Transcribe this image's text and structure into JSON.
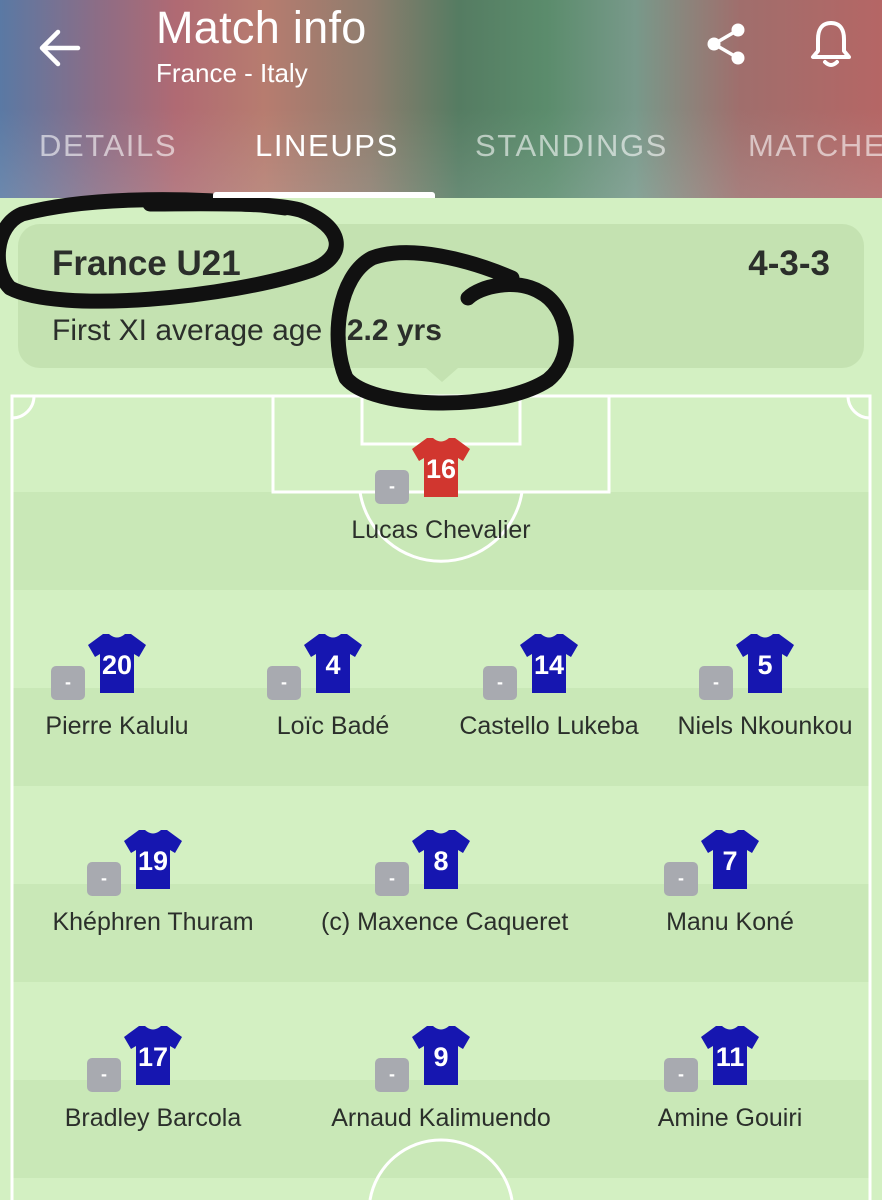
{
  "header": {
    "title": "Match info",
    "subtitle": "France - Italy",
    "back_icon": "arrow-left-icon",
    "share_icon": "share-icon",
    "bell_icon": "bell-icon"
  },
  "tabs": [
    {
      "label": "DETAILS",
      "active": false
    },
    {
      "label": "LINEUPS",
      "active": true
    },
    {
      "label": "STANDINGS",
      "active": false
    },
    {
      "label": "MATCHES",
      "active": false
    }
  ],
  "team": {
    "name": "France U21",
    "formation": "4-3-3",
    "avg_age_label": "First XI average age",
    "avg_age_value": "22.2 yrs"
  },
  "colors": {
    "pitch": "#d3f0c2",
    "pitch_stripe": "#c9e8b7",
    "keeper_shirt": "#d1362f",
    "outfield_shirt": "#1616b0",
    "rating_badge": "#a8aab0"
  },
  "players": [
    {
      "number": "16",
      "name": "Lucas Chevalier",
      "rating": "-",
      "role": "goalkeeper"
    },
    {
      "number": "20",
      "name": "Pierre Kalulu",
      "rating": "-",
      "role": "defender"
    },
    {
      "number": "4",
      "name": "Loïc Badé",
      "rating": "-",
      "role": "defender"
    },
    {
      "number": "14",
      "name": "Castello Lukeba",
      "rating": "-",
      "role": "defender"
    },
    {
      "number": "5",
      "name": "Niels Nkounkou",
      "rating": "-",
      "role": "defender"
    },
    {
      "number": "19",
      "name": "Khéphren Thuram",
      "rating": "-",
      "role": "midfielder"
    },
    {
      "number": "8",
      "name": "(c) Maxence Caqueret",
      "rating": "-",
      "role": "midfielder"
    },
    {
      "number": "7",
      "name": "Manu Koné",
      "rating": "-",
      "role": "midfielder"
    },
    {
      "number": "17",
      "name": "Bradley Barcola",
      "rating": "-",
      "role": "forward"
    },
    {
      "number": "9",
      "name": "Arnaud Kalimuendo",
      "rating": "-",
      "role": "forward"
    },
    {
      "number": "11",
      "name": "Amine Gouiri",
      "rating": "-",
      "role": "forward"
    }
  ]
}
